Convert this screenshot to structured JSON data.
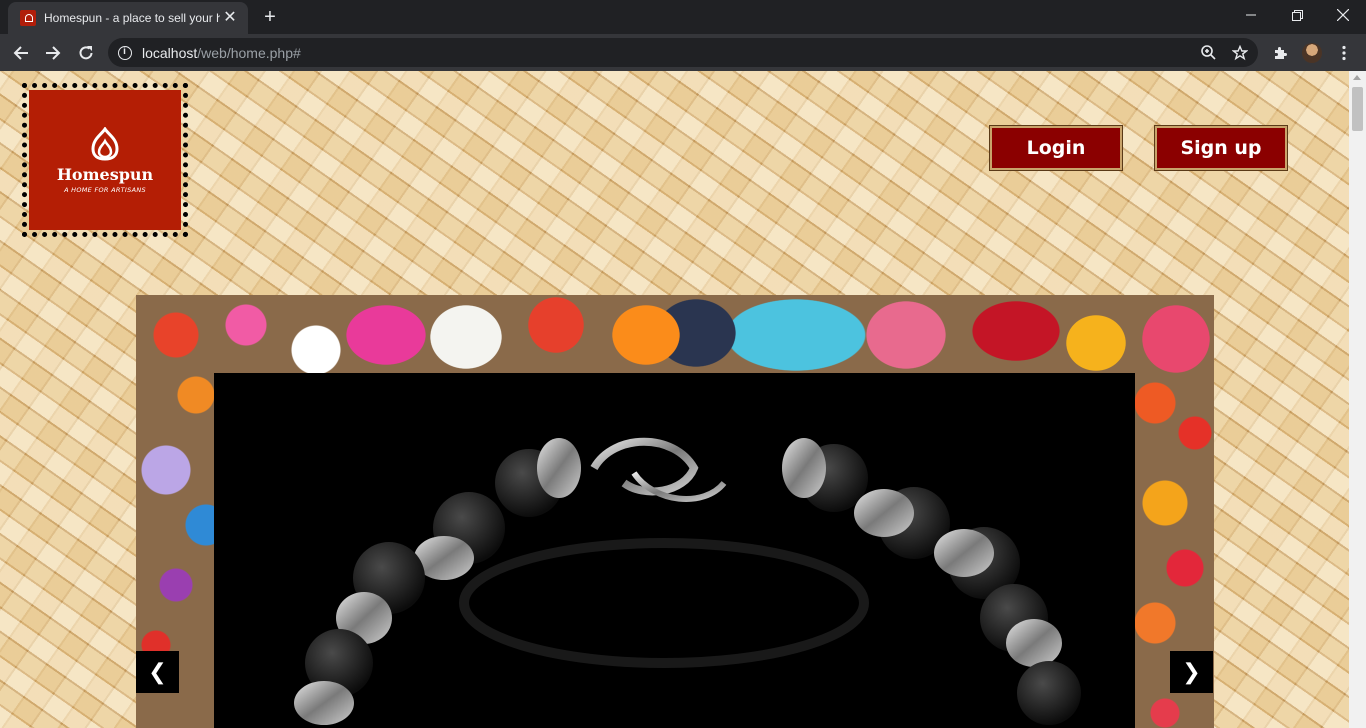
{
  "browser": {
    "tab_title": "Homespun - a place to sell your handmade goods",
    "tab_close": "✕",
    "new_tab": "+",
    "url_host": "localhost",
    "url_path": "/web/home.php#",
    "icons": [
      "back-arrow-icon",
      "forward-arrow-icon",
      "reload-icon",
      "info-icon",
      "zoom-icon",
      "star-icon",
      "extensions-icon",
      "profile-avatar",
      "menu-dots-icon"
    ]
  },
  "header": {
    "logo_name": "Homespun",
    "logo_tagline": "A HOME FOR ARTISANS",
    "login_label": "Login",
    "signup_label": "Sign up"
  },
  "slideshow": {
    "prev_label": "❮",
    "next_label": "❯"
  },
  "colors": {
    "brand_red": "#b41e05",
    "button_bg": "#8b0000"
  }
}
